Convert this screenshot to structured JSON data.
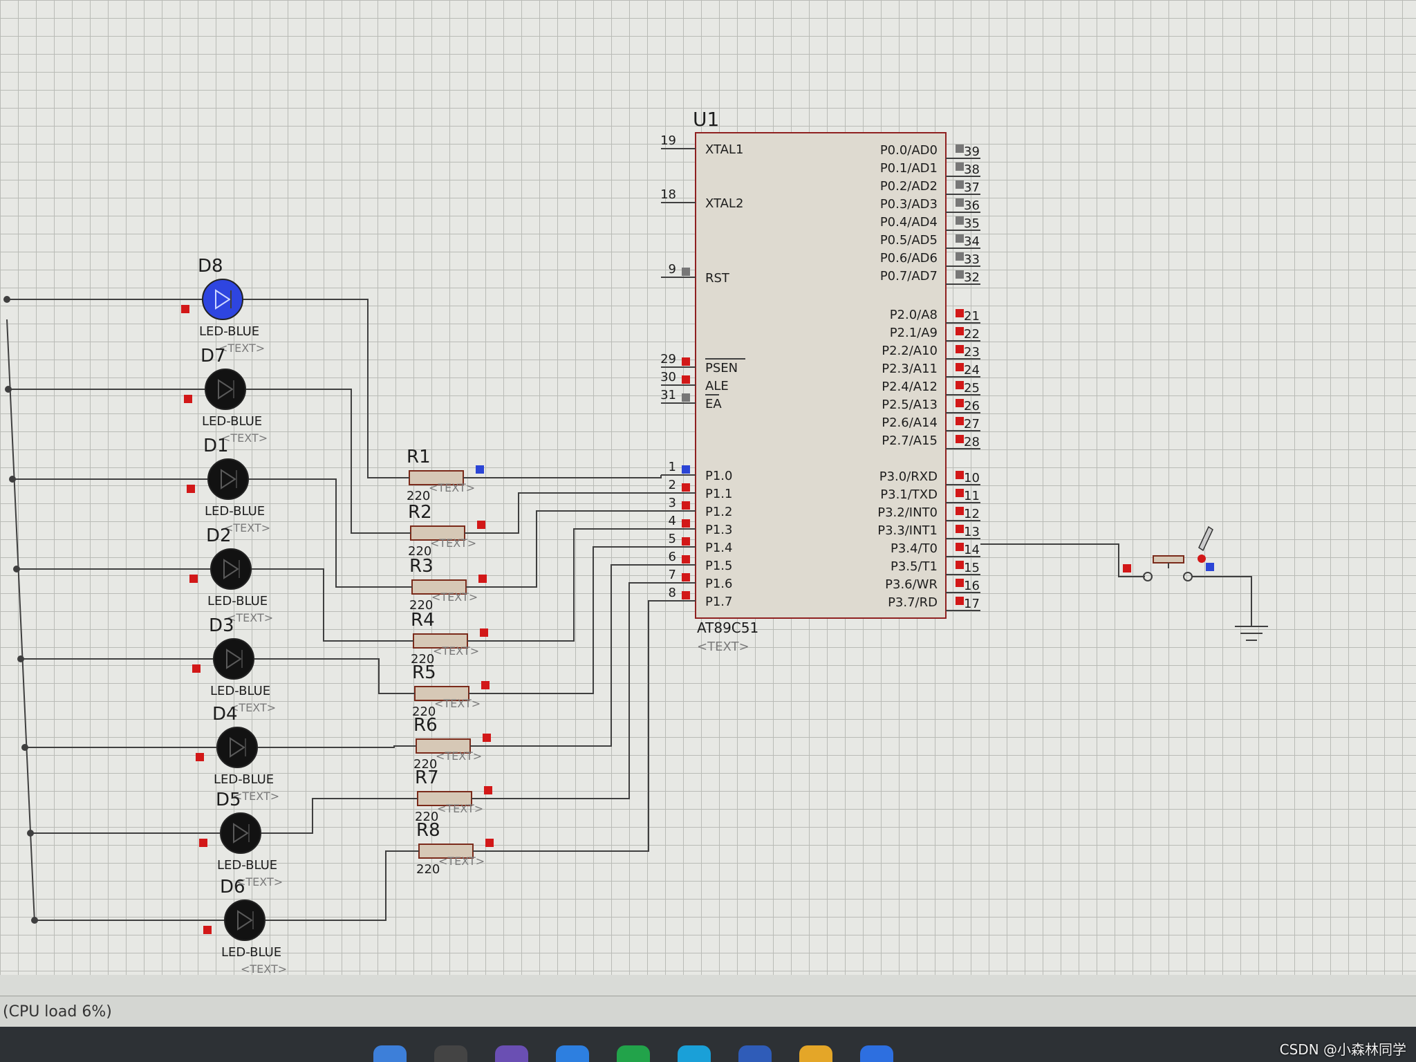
{
  "colors": {
    "wire": "#3f3f3f",
    "chip_fill": "#dedad0",
    "chip_border": "#8f2020",
    "pin_red": "#d21818",
    "pin_blue": "#2b45d6",
    "pin_gray": "#777777",
    "resistor_fill": "#d6c8b6",
    "resistor_border": "#7a2a1a",
    "led_off": "#121212",
    "led_on": "#2e45e0"
  },
  "chip": {
    "ref": "U1",
    "part": "AT89C51",
    "text": "<TEXT>",
    "left_pins": [
      {
        "num": "19",
        "name": "XTAL1",
        "state": "none"
      },
      {
        "num": "18",
        "name": "XTAL2",
        "state": "none"
      },
      {
        "num": "9",
        "name": "RST",
        "state": "gray"
      },
      {
        "num": "29",
        "name": "PSEN",
        "state": "red"
      },
      {
        "num": "30",
        "name": "ALE",
        "state": "red"
      },
      {
        "num": "31",
        "name": "EA",
        "state": "gray"
      },
      {
        "num": "1",
        "name": "P1.0",
        "state": "blue"
      },
      {
        "num": "2",
        "name": "P1.1",
        "state": "red"
      },
      {
        "num": "3",
        "name": "P1.2",
        "state": "red"
      },
      {
        "num": "4",
        "name": "P1.3",
        "state": "red"
      },
      {
        "num": "5",
        "name": "P1.4",
        "state": "red"
      },
      {
        "num": "6",
        "name": "P1.5",
        "state": "red"
      },
      {
        "num": "7",
        "name": "P1.6",
        "state": "red"
      },
      {
        "num": "8",
        "name": "P1.7",
        "state": "red"
      }
    ],
    "right_pins_p0": [
      {
        "num": "39",
        "name": "P0.0/AD0",
        "state": "gray"
      },
      {
        "num": "38",
        "name": "P0.1/AD1",
        "state": "gray"
      },
      {
        "num": "37",
        "name": "P0.2/AD2",
        "state": "gray"
      },
      {
        "num": "36",
        "name": "P0.3/AD3",
        "state": "gray"
      },
      {
        "num": "35",
        "name": "P0.4/AD4",
        "state": "gray"
      },
      {
        "num": "34",
        "name": "P0.5/AD5",
        "state": "gray"
      },
      {
        "num": "33",
        "name": "P0.6/AD6",
        "state": "gray"
      },
      {
        "num": "32",
        "name": "P0.7/AD7",
        "state": "gray"
      }
    ],
    "right_pins_p2": [
      {
        "num": "21",
        "name": "P2.0/A8",
        "state": "red"
      },
      {
        "num": "22",
        "name": "P2.1/A9",
        "state": "red"
      },
      {
        "num": "23",
        "name": "P2.2/A10",
        "state": "red"
      },
      {
        "num": "24",
        "name": "P2.3/A11",
        "state": "red"
      },
      {
        "num": "25",
        "name": "P2.4/A12",
        "state": "red"
      },
      {
        "num": "26",
        "name": "P2.5/A13",
        "state": "red"
      },
      {
        "num": "27",
        "name": "P2.6/A14",
        "state": "red"
      },
      {
        "num": "28",
        "name": "P2.7/A15",
        "state": "red"
      }
    ],
    "right_pins_p3": [
      {
        "num": "10",
        "name": "P3.0/RXD",
        "state": "red"
      },
      {
        "num": "11",
        "name": "P3.1/TXD",
        "state": "red"
      },
      {
        "num": "12",
        "name": "P3.2/INT0",
        "state": "red"
      },
      {
        "num": "13",
        "name": "P3.3/INT1",
        "state": "red"
      },
      {
        "num": "14",
        "name": "P3.4/T0",
        "state": "red"
      },
      {
        "num": "15",
        "name": "P3.5/T1",
        "state": "red"
      },
      {
        "num": "16",
        "name": "P3.6/WR",
        "state": "red"
      },
      {
        "num": "17",
        "name": "P3.7/RD",
        "state": "red"
      }
    ]
  },
  "leds": [
    {
      "ref": "D8",
      "part": "LED-BLUE",
      "text": "<TEXT>",
      "lit": true
    },
    {
      "ref": "D7",
      "part": "LED-BLUE",
      "text": "<TEXT>",
      "lit": false
    },
    {
      "ref": "D1",
      "part": "LED-BLUE",
      "text": "<TEXT>",
      "lit": false
    },
    {
      "ref": "D2",
      "part": "LED-BLUE",
      "text": "<TEXT>",
      "lit": false
    },
    {
      "ref": "D3",
      "part": "LED-BLUE",
      "text": "<TEXT>",
      "lit": false
    },
    {
      "ref": "D4",
      "part": "LED-BLUE",
      "text": "<TEXT>",
      "lit": false
    },
    {
      "ref": "D5",
      "part": "LED-BLUE",
      "text": "<TEXT>",
      "lit": false
    },
    {
      "ref": "D6",
      "part": "LED-BLUE",
      "text": "<TEXT>",
      "lit": false
    }
  ],
  "resistors": [
    {
      "ref": "R1",
      "value": "220",
      "text": "<TEXT>",
      "pin_state": "blue"
    },
    {
      "ref": "R2",
      "value": "220",
      "text": "<TEXT>",
      "pin_state": "red"
    },
    {
      "ref": "R3",
      "value": "220",
      "text": "<TEXT>",
      "pin_state": "red"
    },
    {
      "ref": "R4",
      "value": "220",
      "text": "<TEXT>",
      "pin_state": "red"
    },
    {
      "ref": "R5",
      "value": "220",
      "text": "<TEXT>",
      "pin_state": "red"
    },
    {
      "ref": "R6",
      "value": "220",
      "text": "<TEXT>",
      "pin_state": "red"
    },
    {
      "ref": "R7",
      "value": "220",
      "text": "<TEXT>",
      "pin_state": "red"
    },
    {
      "ref": "R8",
      "value": "220",
      "text": "<TEXT>",
      "pin_state": "red"
    }
  ],
  "status_bar": {
    "text": "(CPU load 6%)"
  },
  "taskbar": {
    "icons": [
      "folder-icon",
      "search-icon",
      "app-icon",
      "browser-icon",
      "wechat-icon",
      "chat-icon",
      "word-icon",
      "emoji-icon",
      "isis-icon"
    ]
  },
  "watermark": "CSDN @小森林同学"
}
